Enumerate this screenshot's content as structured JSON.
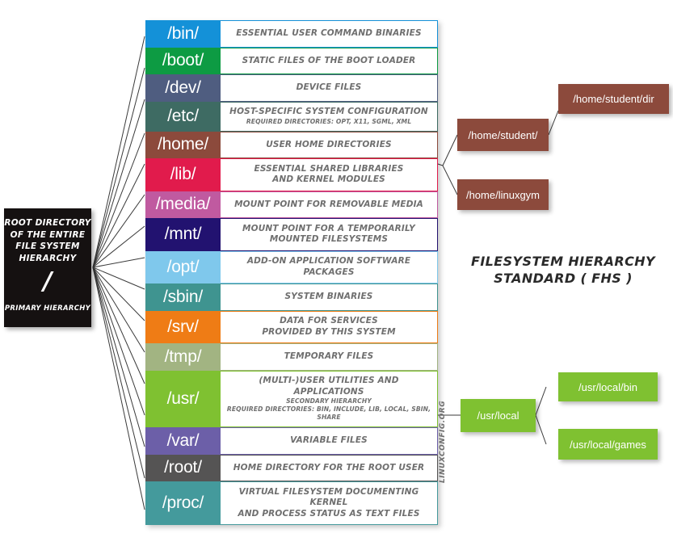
{
  "root_box": {
    "lines": [
      "ROOT DIRECTORY",
      "OF THE ENTIRE",
      "FILE SYSTEM",
      "HIERARCHY"
    ],
    "slash": "/",
    "footer": "PRIMARY HIERARCHY",
    "background": "#151111"
  },
  "title": "FILESYSTEM HIERARCHY\nSTANDARD ( FHS )",
  "title_line1": "FILESYSTEM HIERARCHY",
  "title_line2": "STANDARD ( FHS )",
  "watermark": "LINUXCONFIG.ORG",
  "directories": [
    {
      "name": "/bin/",
      "color": "#1491d8",
      "desc1": "ESSENTIAL USER COMMAND BINARIES",
      "desc2": ""
    },
    {
      "name": "/boot/",
      "color": "#0d9b43",
      "desc1": "STATIC FILES OF THE BOOT LOADER",
      "desc2": ""
    },
    {
      "name": "/dev/",
      "color": "#4f5d80",
      "desc1": "DEVICE FILES",
      "desc2": ""
    },
    {
      "name": "/etc/",
      "color": "#3e6b63",
      "desc1": "HOST-SPECIFIC SYSTEM CONFIGURATION",
      "desc2": "REQUIRED DIRECTORIES: OPT, X11, SGML, XML"
    },
    {
      "name": "/home/",
      "color": "#8c4a3c",
      "desc1": "USER HOME DIRECTORIES",
      "desc2": ""
    },
    {
      "name": "/lib/",
      "color": "#e11b4c",
      "desc1": "ESSENTIAL SHARED LIBRARIES",
      "desc1b": "AND KERNEL MODULES",
      "desc2": ""
    },
    {
      "name": "/media/",
      "color": "#c05aa0",
      "desc1": "MOUNT POINT FOR REMOVABLE MEDIA",
      "desc2": ""
    },
    {
      "name": "/mnt/",
      "color": "#221270",
      "desc1": "MOUNT POINT FOR A TEMPORARILY",
      "desc1b": "MOUNTED FILESYSTEMS",
      "desc2": ""
    },
    {
      "name": "/opt/",
      "color": "#7fc8ec",
      "desc1": "ADD-ON APPLICATION SOFTWARE PACKAGES",
      "desc2": ""
    },
    {
      "name": "/sbin/",
      "color": "#3f9490",
      "desc1": "SYSTEM BINARIES",
      "desc2": ""
    },
    {
      "name": "/srv/",
      "color": "#ef7c15",
      "desc1": "DATA FOR SERVICES",
      "desc1b": "PROVIDED BY THIS SYSTEM",
      "desc2": ""
    },
    {
      "name": "/tmp/",
      "color": "#a2b482",
      "desc1": "TEMPORARY FILES",
      "desc2": ""
    },
    {
      "name": "/usr/",
      "color": "#7fc131",
      "desc1": "(MULTI-)USER UTILITIES AND APPLICATIONS",
      "desc1b": "SECONDARY HIERARCHY",
      "desc2": "REQUIRED DIRECTORIES: BIN, INCLUDE, LIB, LOCAL, SBIN, SHARE"
    },
    {
      "name": "/var/",
      "color": "#6c5fa8",
      "desc1": "VARIABLE FILES",
      "desc2": ""
    },
    {
      "name": "/root/",
      "color": "#555454",
      "desc1": "HOME DIRECTORY FOR THE ROOT USER",
      "desc2": ""
    },
    {
      "name": "/proc/",
      "color": "#449a9c",
      "desc1": "VIRTUAL FILESYSTEM DOCUMENTING KERNEL",
      "desc1b": "AND PROCESS STATUS AS TEXT FILES",
      "desc2": ""
    }
  ],
  "branches": {
    "home": {
      "color": "#8c4a3c",
      "parent": "/home/student/",
      "child": "/home/student/dir",
      "sibling": "/home/linuxgym"
    },
    "usr": {
      "color": "#7fc131",
      "parent": "/usr/local",
      "child1": "/usr/local/bin",
      "child2": "/usr/local/games"
    }
  }
}
